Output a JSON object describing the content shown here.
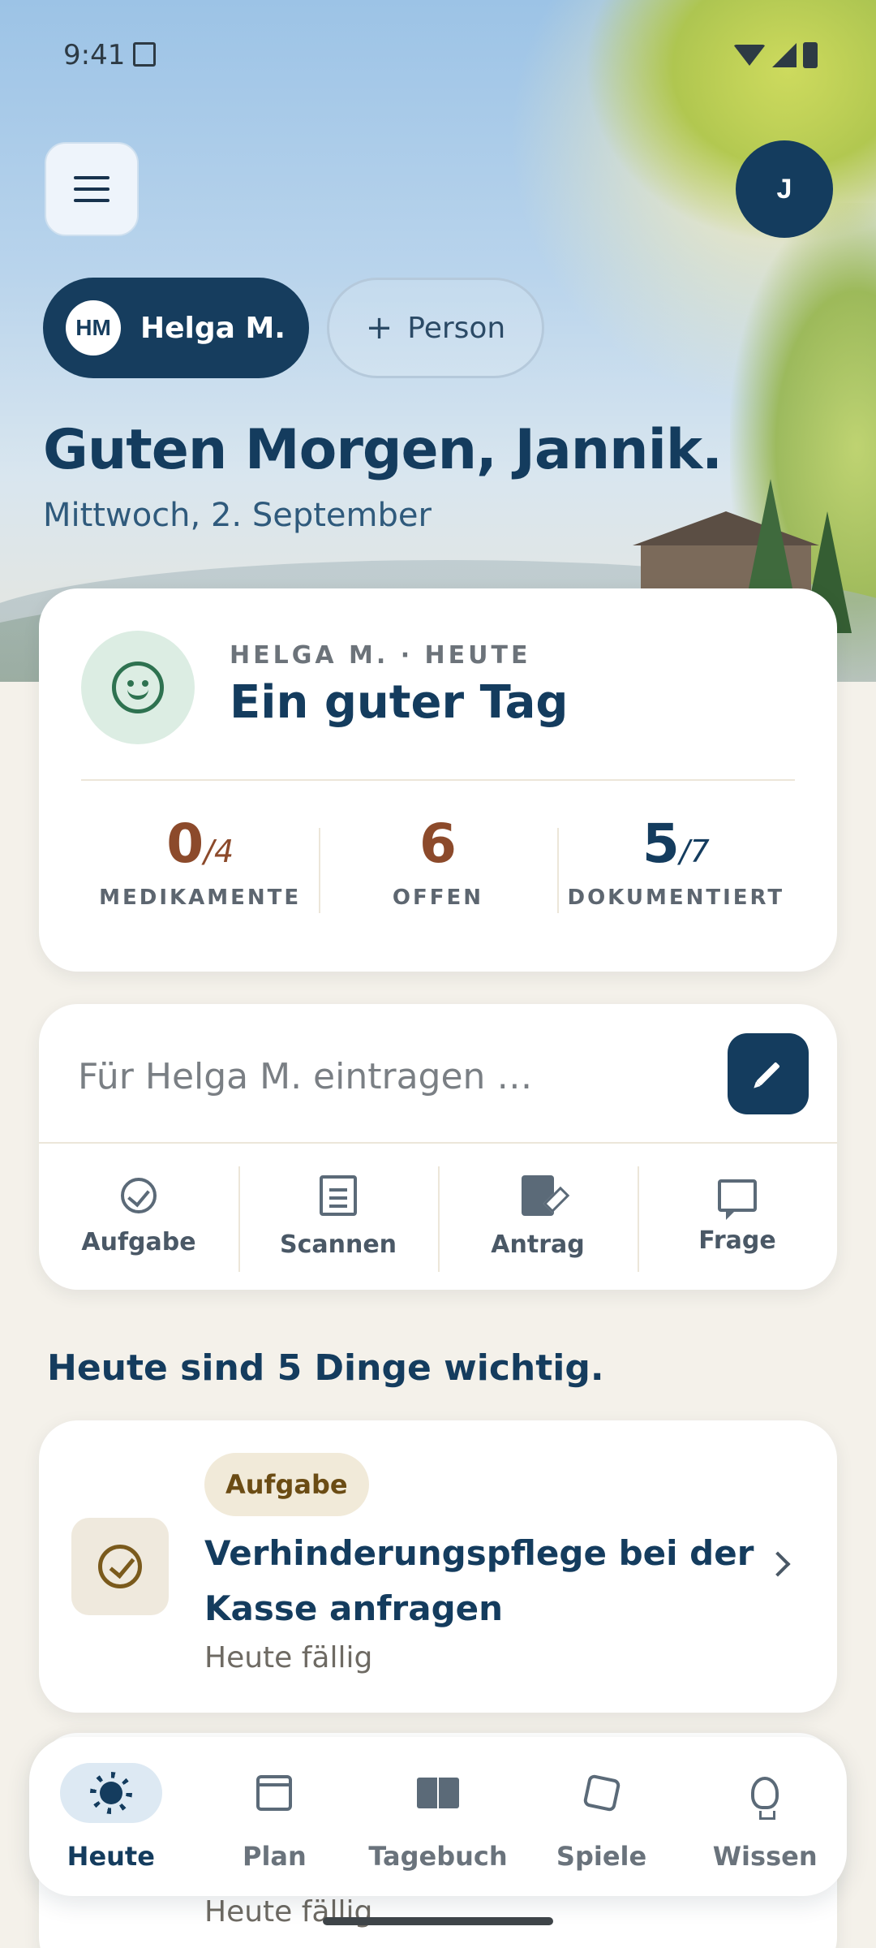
{
  "status_bar": {
    "time": "9:41"
  },
  "header": {
    "user_initial": "J"
  },
  "person_switcher": {
    "active": {
      "initials": "HM",
      "name": "Helga M."
    },
    "add_label": "Person",
    "add_symbol": "+"
  },
  "greeting": {
    "title": "Guten Morgen, Jannik.",
    "date": "Mittwoch, 2. September"
  },
  "status_card": {
    "eyebrow": "HELGA M. · HEUTE",
    "mood": "Ein guter Tag",
    "stats": [
      {
        "value": "0",
        "total": "/4",
        "label": "MEDIKAMENTE"
      },
      {
        "value": "6",
        "total": "",
        "label": "OFFEN"
      },
      {
        "value": "5",
        "total": "/7",
        "label": "DOKUMENTIERT"
      }
    ]
  },
  "entry": {
    "placeholder": "Für Helga M. eintragen …",
    "actions": [
      {
        "label": "Aufgabe",
        "icon": "task-add-icon"
      },
      {
        "label": "Scannen",
        "icon": "scan-icon"
      },
      {
        "label": "Antrag",
        "icon": "document-edit-icon"
      },
      {
        "label": "Frage",
        "icon": "chat-icon"
      }
    ]
  },
  "today": {
    "title": "Heute sind 5 Dinge wichtig.",
    "items": [
      {
        "tag": "Aufgabe",
        "title": "Verhinderungspflege bei der Kasse anfragen",
        "due": "Heute fällig"
      },
      {
        "due": "Heute fällig"
      }
    ]
  },
  "bottom_nav": {
    "items": [
      {
        "label": "Heute",
        "icon": "sun-icon",
        "active": true
      },
      {
        "label": "Plan",
        "icon": "calendar-icon"
      },
      {
        "label": "Tagebuch",
        "icon": "book-icon"
      },
      {
        "label": "Spiele",
        "icon": "puzzle-icon"
      },
      {
        "label": "Wissen",
        "icon": "lightbulb-icon"
      }
    ]
  },
  "colors": {
    "primary": "#143c5e",
    "accent_brown": "#8c4a2b",
    "mood_green": "#2e7250",
    "background": "#f4f1ea"
  }
}
